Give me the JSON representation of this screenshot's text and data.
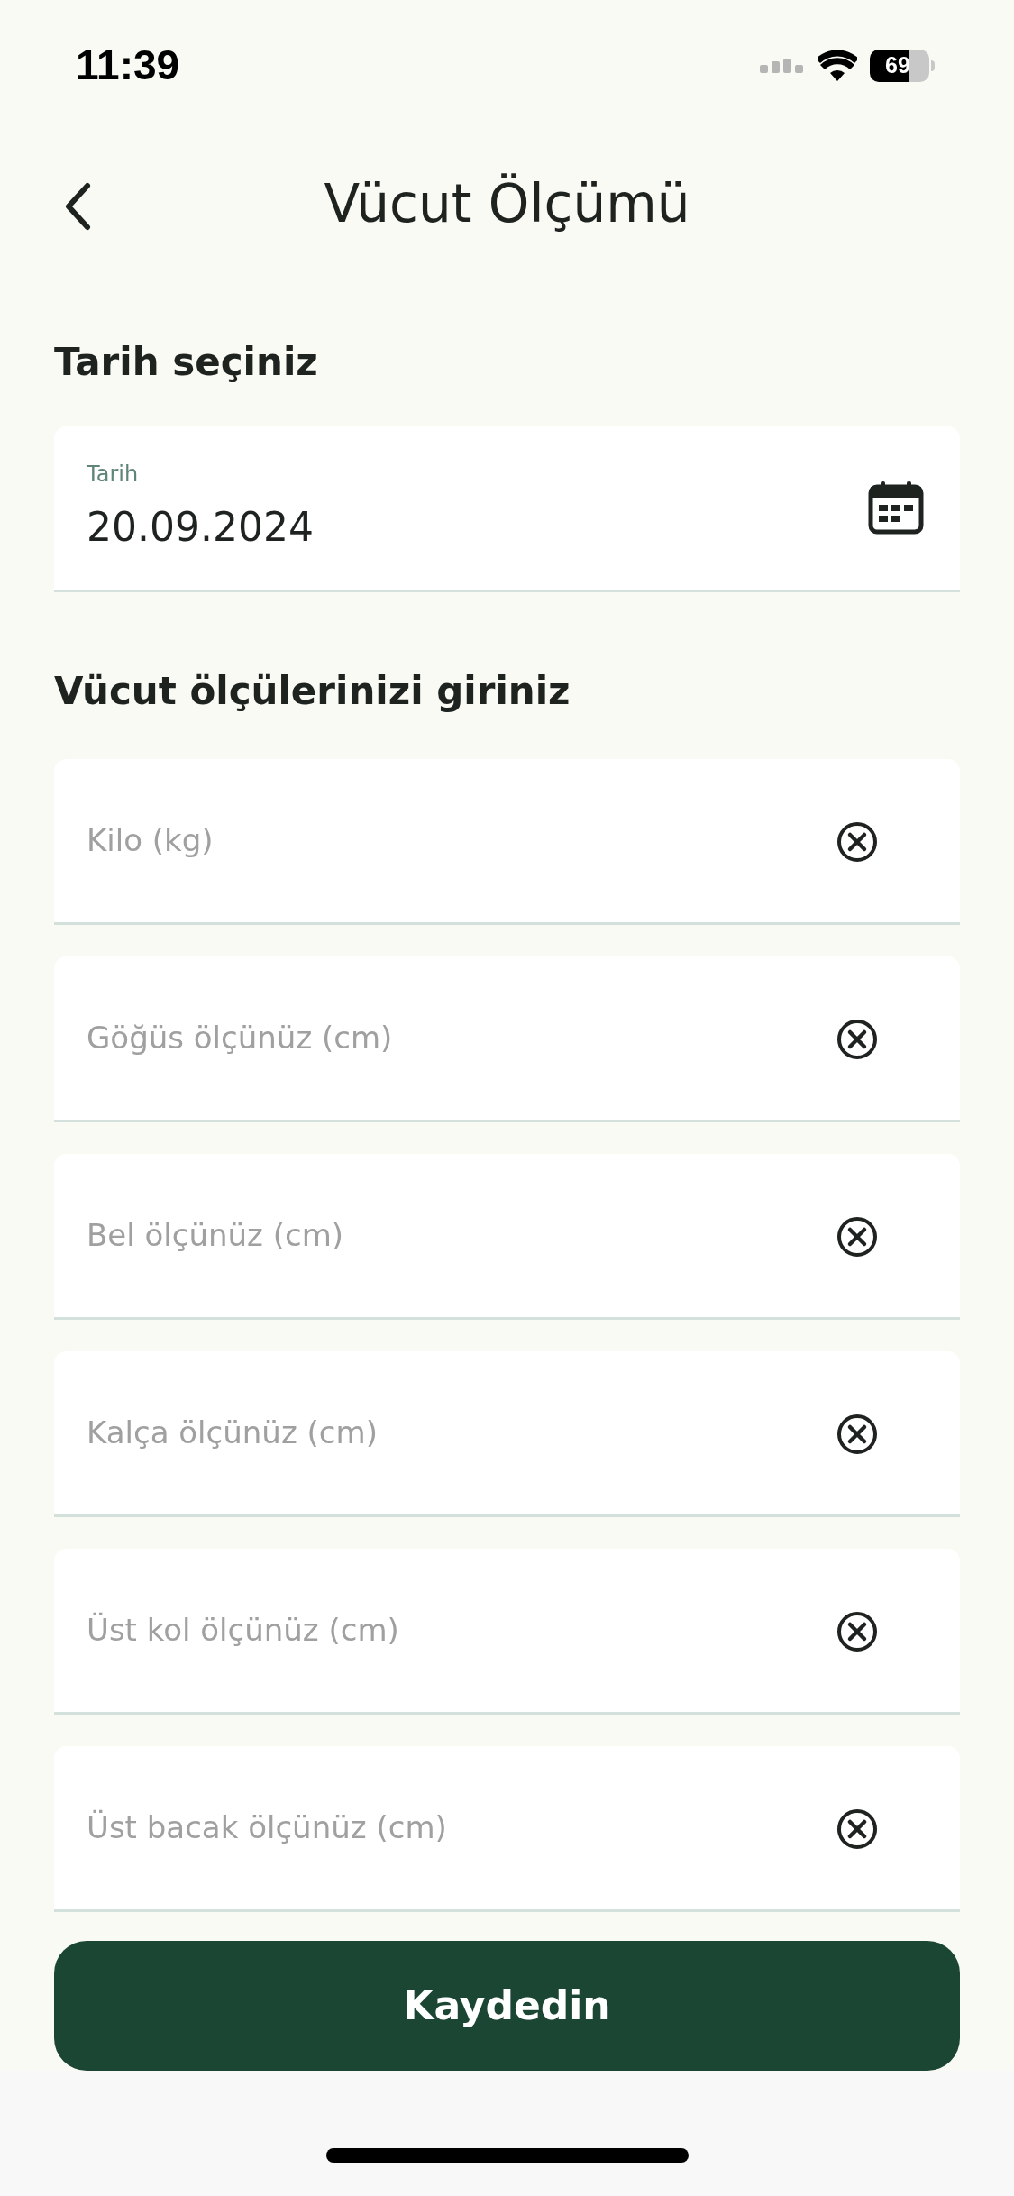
{
  "status_bar": {
    "time": "11:39",
    "battery": "69"
  },
  "header": {
    "title": "Vücut Ölçümü"
  },
  "date_section": {
    "heading": "Tarih seçiniz",
    "field": {
      "label": "Tarih",
      "value": "20.09.2024"
    }
  },
  "measurements_section": {
    "heading": "Vücut ölçülerinizi giriniz",
    "fields": [
      {
        "placeholder": "Kilo (kg)"
      },
      {
        "placeholder": "Göğüs ölçünüz (cm)"
      },
      {
        "placeholder": "Bel ölçünüz (cm)"
      },
      {
        "placeholder": "Kalça ölçünüz (cm)"
      },
      {
        "placeholder": "Üst kol ölçünüz (cm)"
      },
      {
        "placeholder": "Üst bacak ölçünüz (cm)"
      }
    ]
  },
  "save_button": "Kaydedin"
}
